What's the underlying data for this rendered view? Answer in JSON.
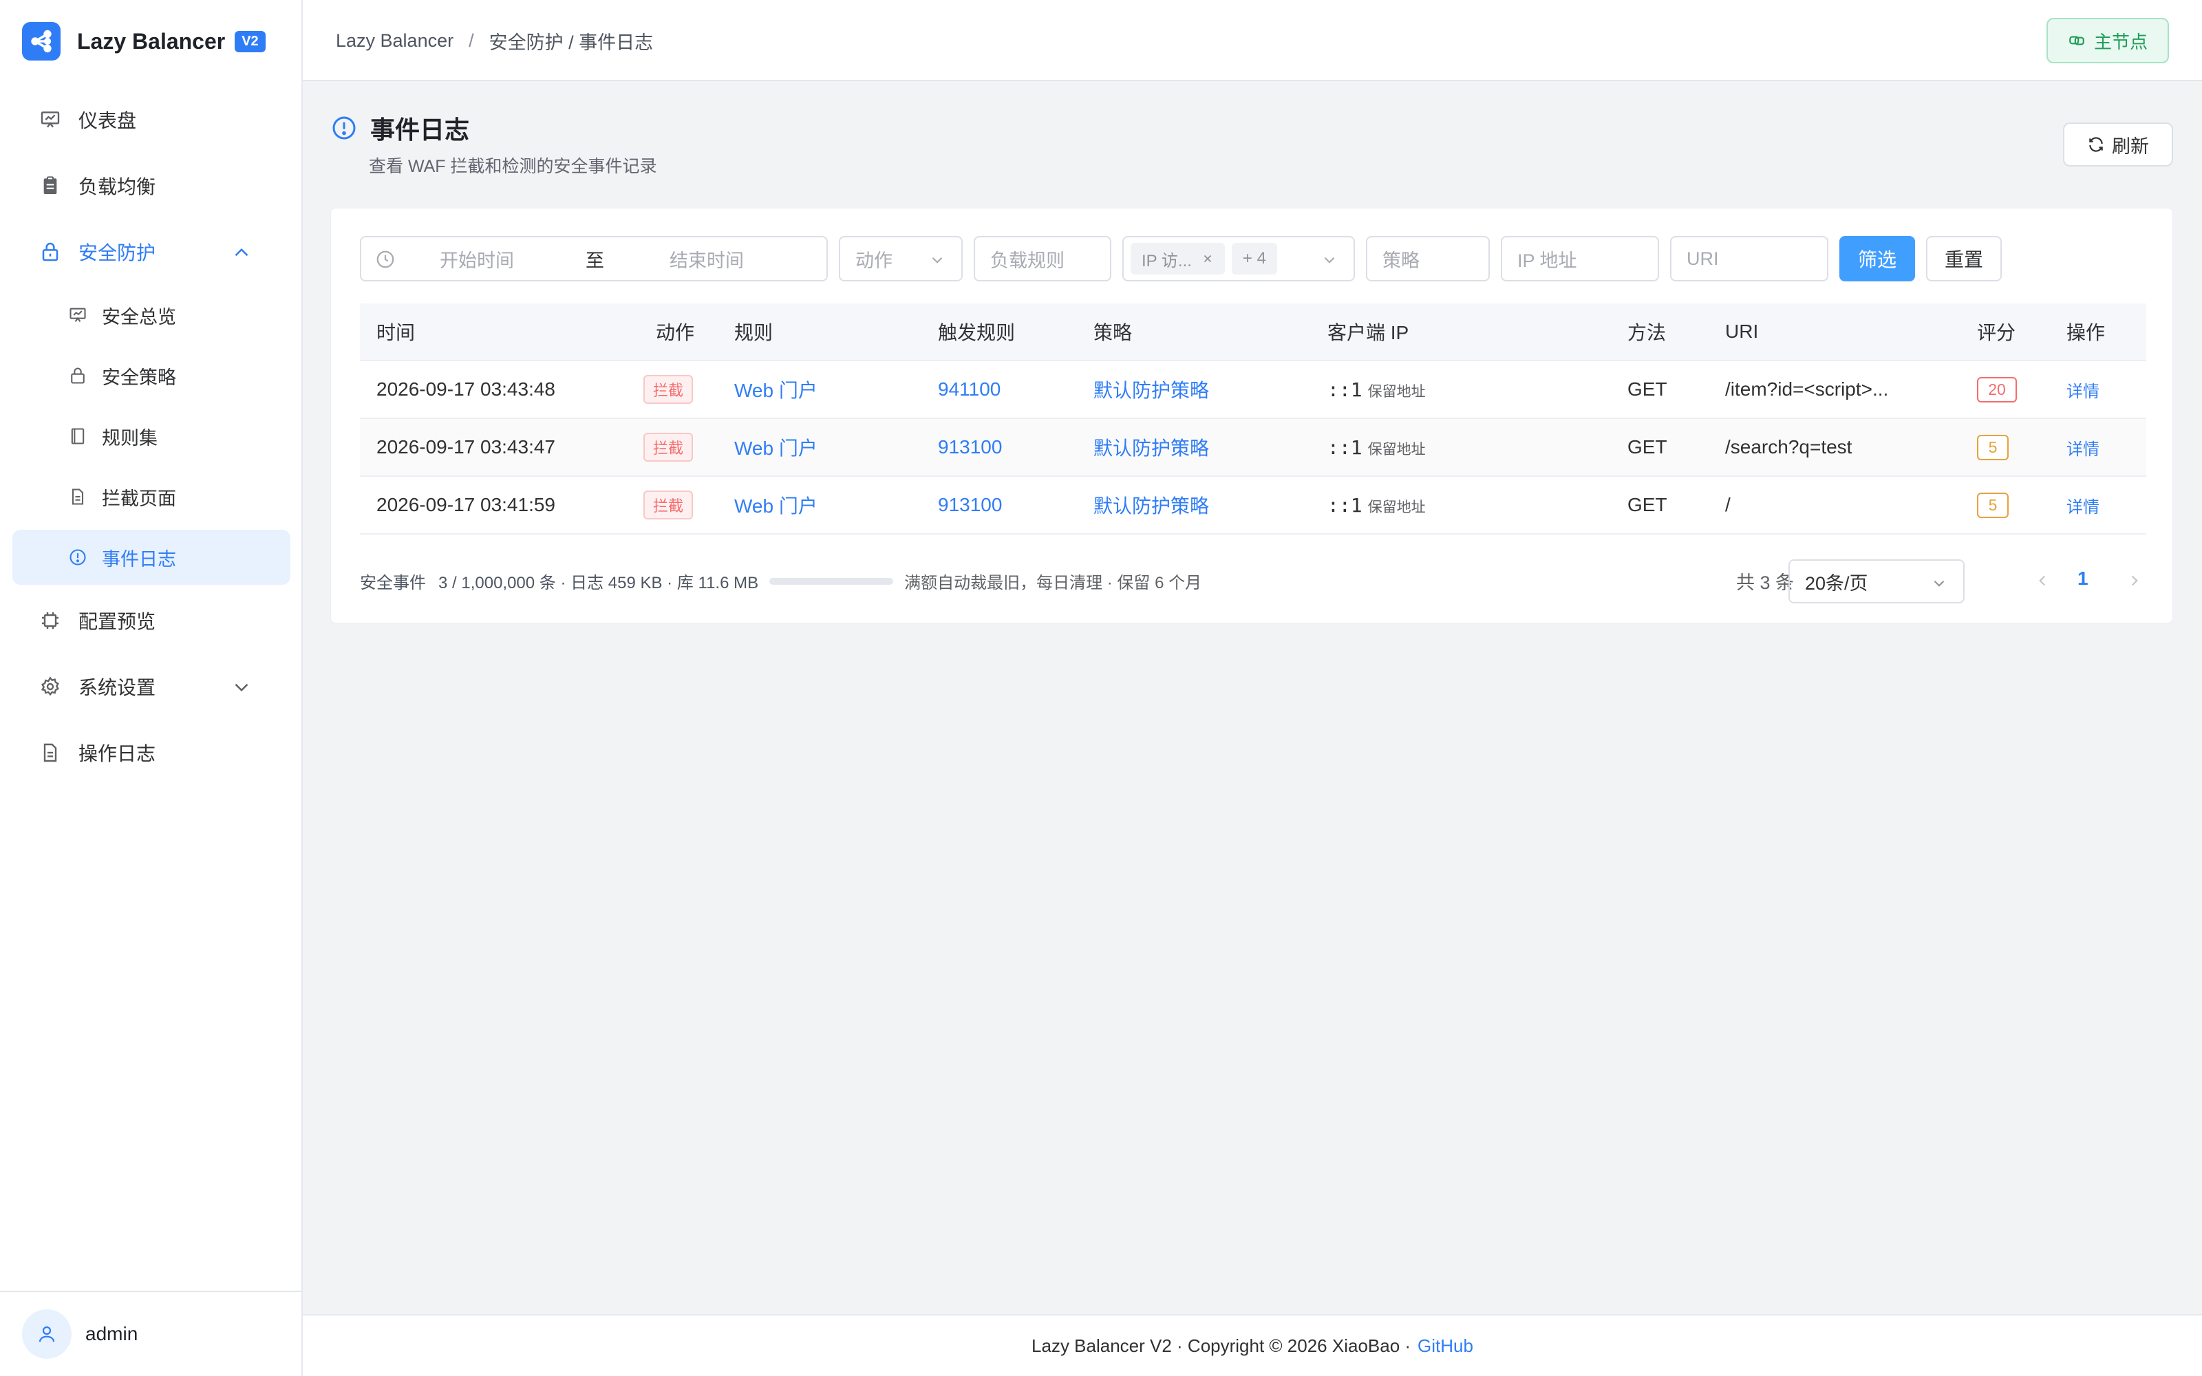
{
  "app": {
    "name": "Lazy Balancer",
    "badge": "V2"
  },
  "colors": {
    "accent": "#2f7df6",
    "primary_button": "#409eff",
    "block_red": "#f56c6c",
    "score_amber": "#e6a23c",
    "node_green": "#1f9d58"
  },
  "sidebar": {
    "items": [
      {
        "label": "仪表盘",
        "icon": "dashboard-icon"
      },
      {
        "label": "负载均衡",
        "icon": "clipboard-icon"
      },
      {
        "label": "安全防护",
        "icon": "lock-icon",
        "expanded": true
      },
      {
        "label": "配置预览",
        "icon": "chip-icon"
      },
      {
        "label": "系统设置",
        "icon": "gear-icon",
        "expanded": false
      },
      {
        "label": "操作日志",
        "icon": "document-icon"
      }
    ],
    "security_sub": [
      {
        "label": "安全总览",
        "icon": "monitor-icon"
      },
      {
        "label": "安全策略",
        "icon": "lock-icon"
      },
      {
        "label": "规则集",
        "icon": "book-icon"
      },
      {
        "label": "拦截页面",
        "icon": "document-icon"
      },
      {
        "label": "事件日志",
        "icon": "info-circle-icon",
        "active": true
      }
    ],
    "user": "admin"
  },
  "header": {
    "breadcrumb_root": "Lazy Balancer",
    "breadcrumb_sep": "/",
    "breadcrumb_current": "安全防护 / 事件日志",
    "node_button": "主节点"
  },
  "page": {
    "title": "事件日志",
    "description": "查看 WAF 拦截和检测的安全事件记录",
    "refresh_label": "刷新"
  },
  "filters": {
    "start_placeholder": "开始时间",
    "to_label": "至",
    "end_placeholder": "结束时间",
    "action_placeholder": "动作",
    "lb_placeholder": "负载规则",
    "tag_1": "IP 访...",
    "tag_more": "+ 4",
    "policy_placeholder": "策略",
    "ip_placeholder": "IP 地址",
    "uri_placeholder": "URI",
    "filter_button": "筛选",
    "reset_button": "重置"
  },
  "table": {
    "headers": {
      "time": "时间",
      "action": "动作",
      "rule": "规则",
      "trigger": "触发规则",
      "policy": "策略",
      "client_ip": "客户端 IP",
      "method": "方法",
      "uri": "URI",
      "score": "评分",
      "op": "操作"
    },
    "rows": [
      {
        "time": "2026-09-17 03:43:48",
        "action": "拦截",
        "rule": "Web 门户",
        "trigger": "941100",
        "policy": "默认防护策略",
        "ip": "::1",
        "ip_note": "保留地址",
        "method": "GET",
        "uri": "/item?id=<script>...",
        "score": "20",
        "op": "详情"
      },
      {
        "time": "2026-09-17 03:43:47",
        "action": "拦截",
        "rule": "Web 门户",
        "trigger": "913100",
        "policy": "默认防护策略",
        "ip": "::1",
        "ip_note": "保留地址",
        "method": "GET",
        "uri": "/search?q=test",
        "score": "5",
        "op": "详情"
      },
      {
        "time": "2026-09-17 03:41:59",
        "action": "拦截",
        "rule": "Web 门户",
        "trigger": "913100",
        "policy": "默认防护策略",
        "ip": "::1",
        "ip_note": "保留地址",
        "method": "GET",
        "uri": "/",
        "score": "5",
        "op": "详情"
      }
    ]
  },
  "stats": {
    "label": "安全事件",
    "summary": "3 / 1,000,000 条 · 日志 459 KB · 库 11.6 MB",
    "usage_fraction": 0.0,
    "note": "满额自动裁最旧，每日清理 · 保留 6 个月"
  },
  "pagination": {
    "total": "共 3 条",
    "page_size": "20条/页",
    "current": "1"
  },
  "footer": {
    "text": "Lazy Balancer V2 · Copyright © 2026 XiaoBao ·",
    "link": "GitHub"
  }
}
